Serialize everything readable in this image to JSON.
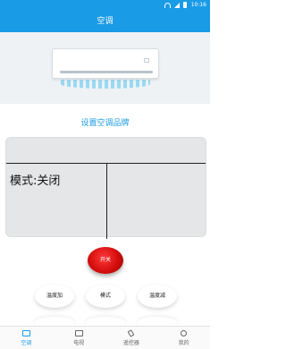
{
  "status_bar": {
    "time": "10:16"
  },
  "app_bar": {
    "title": "空调"
  },
  "brand_link": "设置空调品牌",
  "display": {
    "mode_text": "模式:关闭"
  },
  "power": {
    "label": "开关"
  },
  "controls": {
    "temp_up": "温度加",
    "mode": "模式",
    "temp_down": "温度减"
  },
  "tabs": {
    "ac": "空调",
    "tv": "电视",
    "remote": "遥控器",
    "mine": "我的"
  },
  "colors": {
    "accent": "#1a9be6",
    "power": "#d40d0d"
  }
}
